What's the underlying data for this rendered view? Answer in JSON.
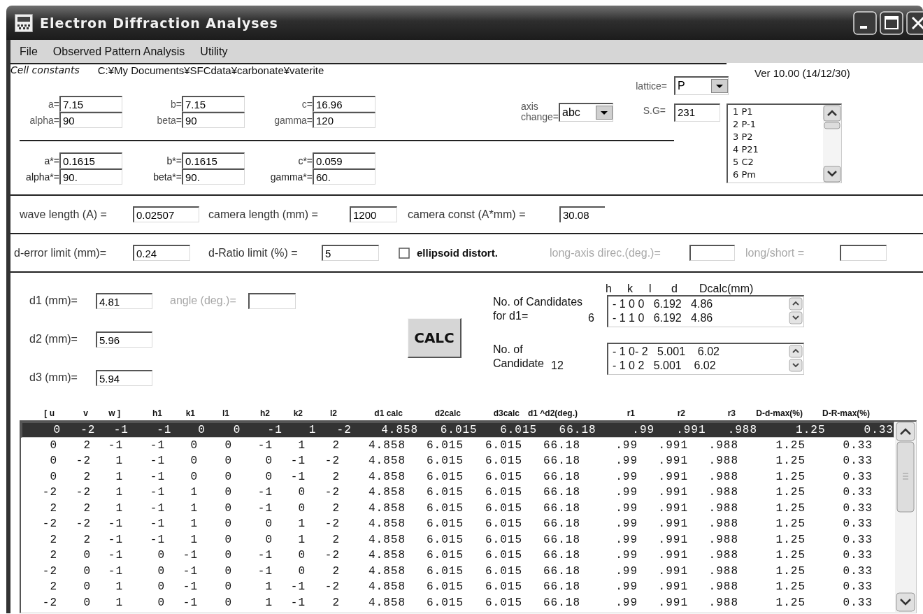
{
  "window": {
    "title": "Electron Diffraction Analyses"
  },
  "menu": [
    {
      "label": "File"
    },
    {
      "label": "Observed Pattern Analysis"
    },
    {
      "label": "Utility"
    }
  ],
  "cell_constants": {
    "heading": "Cell constants",
    "path": "C:¥My Documents¥SFCdata¥carbonate¥vaterite",
    "version": "Ver 10.00 (14/12/30)",
    "real": [
      {
        "label": "a=",
        "value": "7.15"
      },
      {
        "label": "b=",
        "value": "7.15"
      },
      {
        "label": "c=",
        "value": "16.96"
      },
      {
        "label": "alpha=",
        "value": "90"
      },
      {
        "label": "beta=",
        "value": "90"
      },
      {
        "label": "gamma=",
        "value": "120"
      }
    ],
    "reciprocal": [
      {
        "label": "a*=",
        "value": "0.1615"
      },
      {
        "label": "b*=",
        "value": "0.1615"
      },
      {
        "label": "c*=",
        "value": "0.059"
      },
      {
        "label": "alpha*=",
        "value": "90."
      },
      {
        "label": "beta*=",
        "value": "90."
      },
      {
        "label": "gamma*=",
        "value": "60."
      }
    ],
    "axis_change": {
      "label": "axis change=",
      "value": "abc"
    },
    "lattice": {
      "label": "lattice=",
      "value": "P"
    },
    "space_group": {
      "label": "S.G=",
      "value": "231"
    },
    "space_group_list": [
      {
        "label": "1 P1",
        "selected": false
      },
      {
        "label": "2 P-1",
        "selected": false
      },
      {
        "label": "3 P2",
        "selected": false
      },
      {
        "label": "4 P21",
        "selected": false
      },
      {
        "label": "5 C2",
        "selected": false
      },
      {
        "label": "6 Pm",
        "selected": false
      }
    ]
  },
  "optics": [
    {
      "label": "wave length (A) =",
      "value": "0.02507"
    },
    {
      "label": "camera length (mm) =",
      "value": "1200"
    },
    {
      "label": "camera const (A*mm) =",
      "value": "30.08"
    }
  ],
  "limits": {
    "d_error": {
      "label": "d-error limit (mm)=",
      "value": "0.24"
    },
    "d_ratio": {
      "label": "d-Ratio limit (%) =",
      "value": "5"
    },
    "ellipsoid": {
      "label": "ellipsoid distort.",
      "checked": false
    },
    "long_axis": {
      "label": "long-axis direc.(deg.)=",
      "disabled": true
    },
    "long_short": {
      "label": "long/short =",
      "disabled": true
    }
  },
  "spacings": [
    {
      "label": "d1 (mm)=",
      "value": "4.81"
    },
    {
      "label": "d2 (mm)=",
      "value": "5.96"
    },
    {
      "label": "d3 (mm)=",
      "value": "5.94"
    }
  ],
  "angle": {
    "label": "angle (deg.)=",
    "disabled": true
  },
  "calc_button": "CALC",
  "candidate_columns": [
    "h",
    "k",
    "l",
    "d",
    "Dcalc(mm)"
  ],
  "candidates": [
    {
      "label": "No. of Candidates for d1=",
      "count": "6",
      "rows": [
        "- 1 0 0   6.192   4.86",
        "- 1 1 0   6.192   4.86"
      ]
    },
    {
      "label": "No. of Candidate",
      "count": "12",
      "rows": [
        "- 1 0- 2   5.001    6.02",
        "- 1 0 2   5.001    6.02"
      ]
    }
  ],
  "table": {
    "columns": [
      "[ u",
      "v",
      "w ]",
      "h1",
      "k1",
      "l1",
      "h2",
      "k2",
      "l2",
      "d1 calc",
      "d2calc",
      "d3calc",
      "d1 ^d2(deg.)",
      "r1",
      "r2",
      "r3",
      "D-d-max(%)",
      "D-R-max(%)"
    ],
    "rows": [
      {
        "selected": true,
        "cells": [
          "0",
          "-2",
          "-1",
          "-1",
          "0",
          "0",
          "-1",
          "1",
          "-2",
          "4.858",
          "6.015",
          "6.015",
          "66.18",
          ".99",
          ".991",
          ".988",
          "1.25",
          "0.33"
        ]
      },
      {
        "selected": false,
        "cells": [
          "0",
          "2",
          "-1",
          "-1",
          "0",
          "0",
          "-1",
          "1",
          "2",
          "4.858",
          "6.015",
          "6.015",
          "66.18",
          ".99",
          ".991",
          ".988",
          "1.25",
          "0.33"
        ]
      },
      {
        "selected": false,
        "cells": [
          "0",
          "-2",
          "1",
          "-1",
          "0",
          "0",
          "0",
          "-1",
          "-2",
          "4.858",
          "6.015",
          "6.015",
          "66.18",
          ".99",
          ".991",
          ".988",
          "1.25",
          "0.33"
        ]
      },
      {
        "selected": false,
        "cells": [
          "0",
          "2",
          "1",
          "-1",
          "0",
          "0",
          "0",
          "-1",
          "2",
          "4.858",
          "6.015",
          "6.015",
          "66.18",
          ".99",
          ".991",
          ".988",
          "1.25",
          "0.33"
        ]
      },
      {
        "selected": false,
        "cells": [
          "-2",
          "-2",
          "1",
          "-1",
          "1",
          "0",
          "-1",
          "0",
          "-2",
          "4.858",
          "6.015",
          "6.015",
          "66.18",
          ".99",
          ".991",
          ".988",
          "1.25",
          "0.33"
        ]
      },
      {
        "selected": false,
        "cells": [
          "2",
          "2",
          "1",
          "-1",
          "1",
          "0",
          "-1",
          "0",
          "2",
          "4.858",
          "6.015",
          "6.015",
          "66.18",
          ".99",
          ".991",
          ".988",
          "1.25",
          "0.33"
        ]
      },
      {
        "selected": false,
        "cells": [
          "-2",
          "-2",
          "-1",
          "-1",
          "1",
          "0",
          "0",
          "1",
          "-2",
          "4.858",
          "6.015",
          "6.015",
          "66.18",
          ".99",
          ".991",
          ".988",
          "1.25",
          "0.33"
        ]
      },
      {
        "selected": false,
        "cells": [
          "2",
          "2",
          "-1",
          "-1",
          "1",
          "0",
          "0",
          "1",
          "2",
          "4.858",
          "6.015",
          "6.015",
          "66.18",
          ".99",
          ".991",
          ".988",
          "1.25",
          "0.33"
        ]
      },
      {
        "selected": false,
        "cells": [
          "2",
          "0",
          "-1",
          "0",
          "-1",
          "0",
          "-1",
          "0",
          "-2",
          "4.858",
          "6.015",
          "6.015",
          "66.18",
          ".99",
          ".991",
          ".988",
          "1.25",
          "0.33"
        ]
      },
      {
        "selected": false,
        "cells": [
          "-2",
          "0",
          "-1",
          "0",
          "-1",
          "0",
          "-1",
          "0",
          "2",
          "4.858",
          "6.015",
          "6.015",
          "66.18",
          ".99",
          ".991",
          ".988",
          "1.25",
          "0.33"
        ]
      },
      {
        "selected": false,
        "cells": [
          "2",
          "0",
          "1",
          "0",
          "-1",
          "0",
          "1",
          "-1",
          "-2",
          "4.858",
          "6.015",
          "6.015",
          "66.18",
          ".99",
          ".991",
          ".988",
          "1.25",
          "0.33"
        ]
      },
      {
        "selected": false,
        "cells": [
          "-2",
          "0",
          "1",
          "0",
          "-1",
          "0",
          "1",
          "-1",
          "2",
          "4.858",
          "6.015",
          "6.015",
          "66.18",
          ".99",
          ".991",
          ".988",
          "1.25",
          "0.33"
        ]
      }
    ]
  }
}
